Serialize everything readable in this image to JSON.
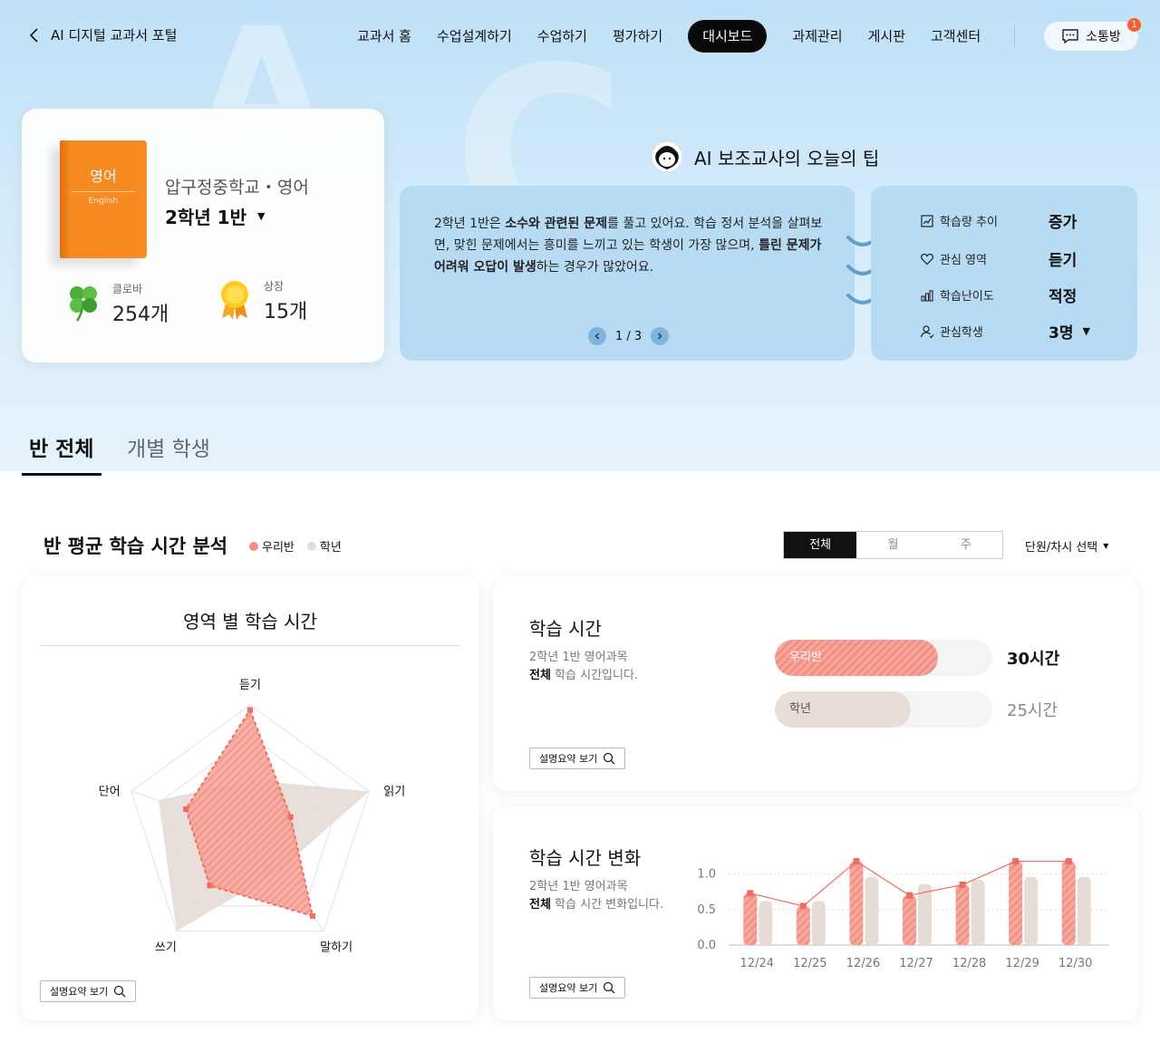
{
  "nav": {
    "back_label": "AI 디지털 교과서 포털",
    "menu": [
      "교과서 홈",
      "수업설계하기",
      "수업하기",
      "평가하기",
      "대시보드",
      "과제관리",
      "게시판",
      "고객센터"
    ],
    "chat_label": "소통방",
    "chat_badge": "1"
  },
  "class_card": {
    "book_title": "영어",
    "book_subtitle": "English",
    "school": "압구정중학교・영어",
    "grade": "2학년 1반",
    "clover_label": "클로바",
    "clover_value": "254개",
    "award_label": "상장",
    "award_value": "15개"
  },
  "tip": {
    "title": "AI 보조교사의 오늘의 팁",
    "text_parts": [
      "2학년 1반은 ",
      "소수와 관련된 문제",
      "를 풀고 있어요. 학습 정서 분석을 살펴보면, 맞힌 문제에서는 흥미를 느끼고 있는 학생이 가장 많으며, ",
      "틀린 문제가 어려워 오답이 발생",
      "하는 경우가 많았어요."
    ],
    "pager": "1 / 3",
    "stats": [
      {
        "label": "학습량 추이",
        "value": "증가",
        "icon": "trend-icon"
      },
      {
        "label": "관심 영역",
        "value": "듣기",
        "icon": "heart-icon"
      },
      {
        "label": "학습난이도",
        "value": "적정",
        "icon": "bar-chart-icon"
      },
      {
        "label": "관심학생",
        "value": "3명",
        "icon": "user-icon"
      }
    ]
  },
  "tabs": [
    "반 전체",
    "개별 학생"
  ],
  "analysis": {
    "title": "반 평균 학습 시간 분석",
    "legend_class": "우리반",
    "legend_grade": "학년",
    "period_options": [
      "전체",
      "월",
      "주"
    ],
    "unit_select": "단원/차시 선택",
    "summary_label": "설명요약 보기"
  },
  "time_card": {
    "title": "학습 시간",
    "sub_line1": "2학년 1반 영어과목",
    "sub_bold": "전체",
    "sub_rest": " 학습 시간입니다.",
    "class_label": "우리반",
    "class_value": "30시간",
    "grade_label": "학년",
    "grade_value": "25시간"
  },
  "change_card": {
    "title": "학습 시간 변화",
    "sub_line1": "2학년 1반 영어과목",
    "sub_bold": "전체",
    "sub_rest": " 학습 시간 변화입니다."
  },
  "colors": {
    "class": "#f48f83",
    "grade": "#e6dcd6",
    "accent": "#111111",
    "badge": "#ff5a29"
  },
  "chart_data": [
    {
      "type": "radar",
      "title": "영역 별 학습 시간",
      "axes": [
        "듣기",
        "읽기",
        "말하기",
        "쓰기",
        "단어"
      ],
      "max": 1.0,
      "series": [
        {
          "name": "우리반",
          "values": [
            0.96,
            0.34,
            0.85,
            0.55,
            0.54
          ]
        },
        {
          "name": "학년",
          "values": [
            0.4,
            1.0,
            0.4,
            1.0,
            0.77
          ]
        }
      ]
    },
    {
      "type": "bar",
      "title": "학습 시간",
      "categories": [
        "우리반",
        "학년"
      ],
      "values": [
        30,
        25
      ],
      "max": 40
    },
    {
      "type": "bar",
      "title": "학습 시간 변화",
      "categories": [
        "12/24",
        "12/25",
        "12/26",
        "12/27",
        "12/28",
        "12/29",
        "12/30"
      ],
      "ylim": [
        0,
        1.2
      ],
      "yticks": [
        "0.0",
        "0.5",
        "1.0"
      ],
      "series": [
        {
          "name": "우리반",
          "values": [
            0.73,
            0.55,
            1.18,
            0.7,
            0.85,
            1.18,
            1.18
          ]
        },
        {
          "name": "학년",
          "values": [
            0.62,
            0.62,
            0.96,
            0.86,
            0.92,
            0.96,
            0.96
          ]
        }
      ]
    }
  ]
}
